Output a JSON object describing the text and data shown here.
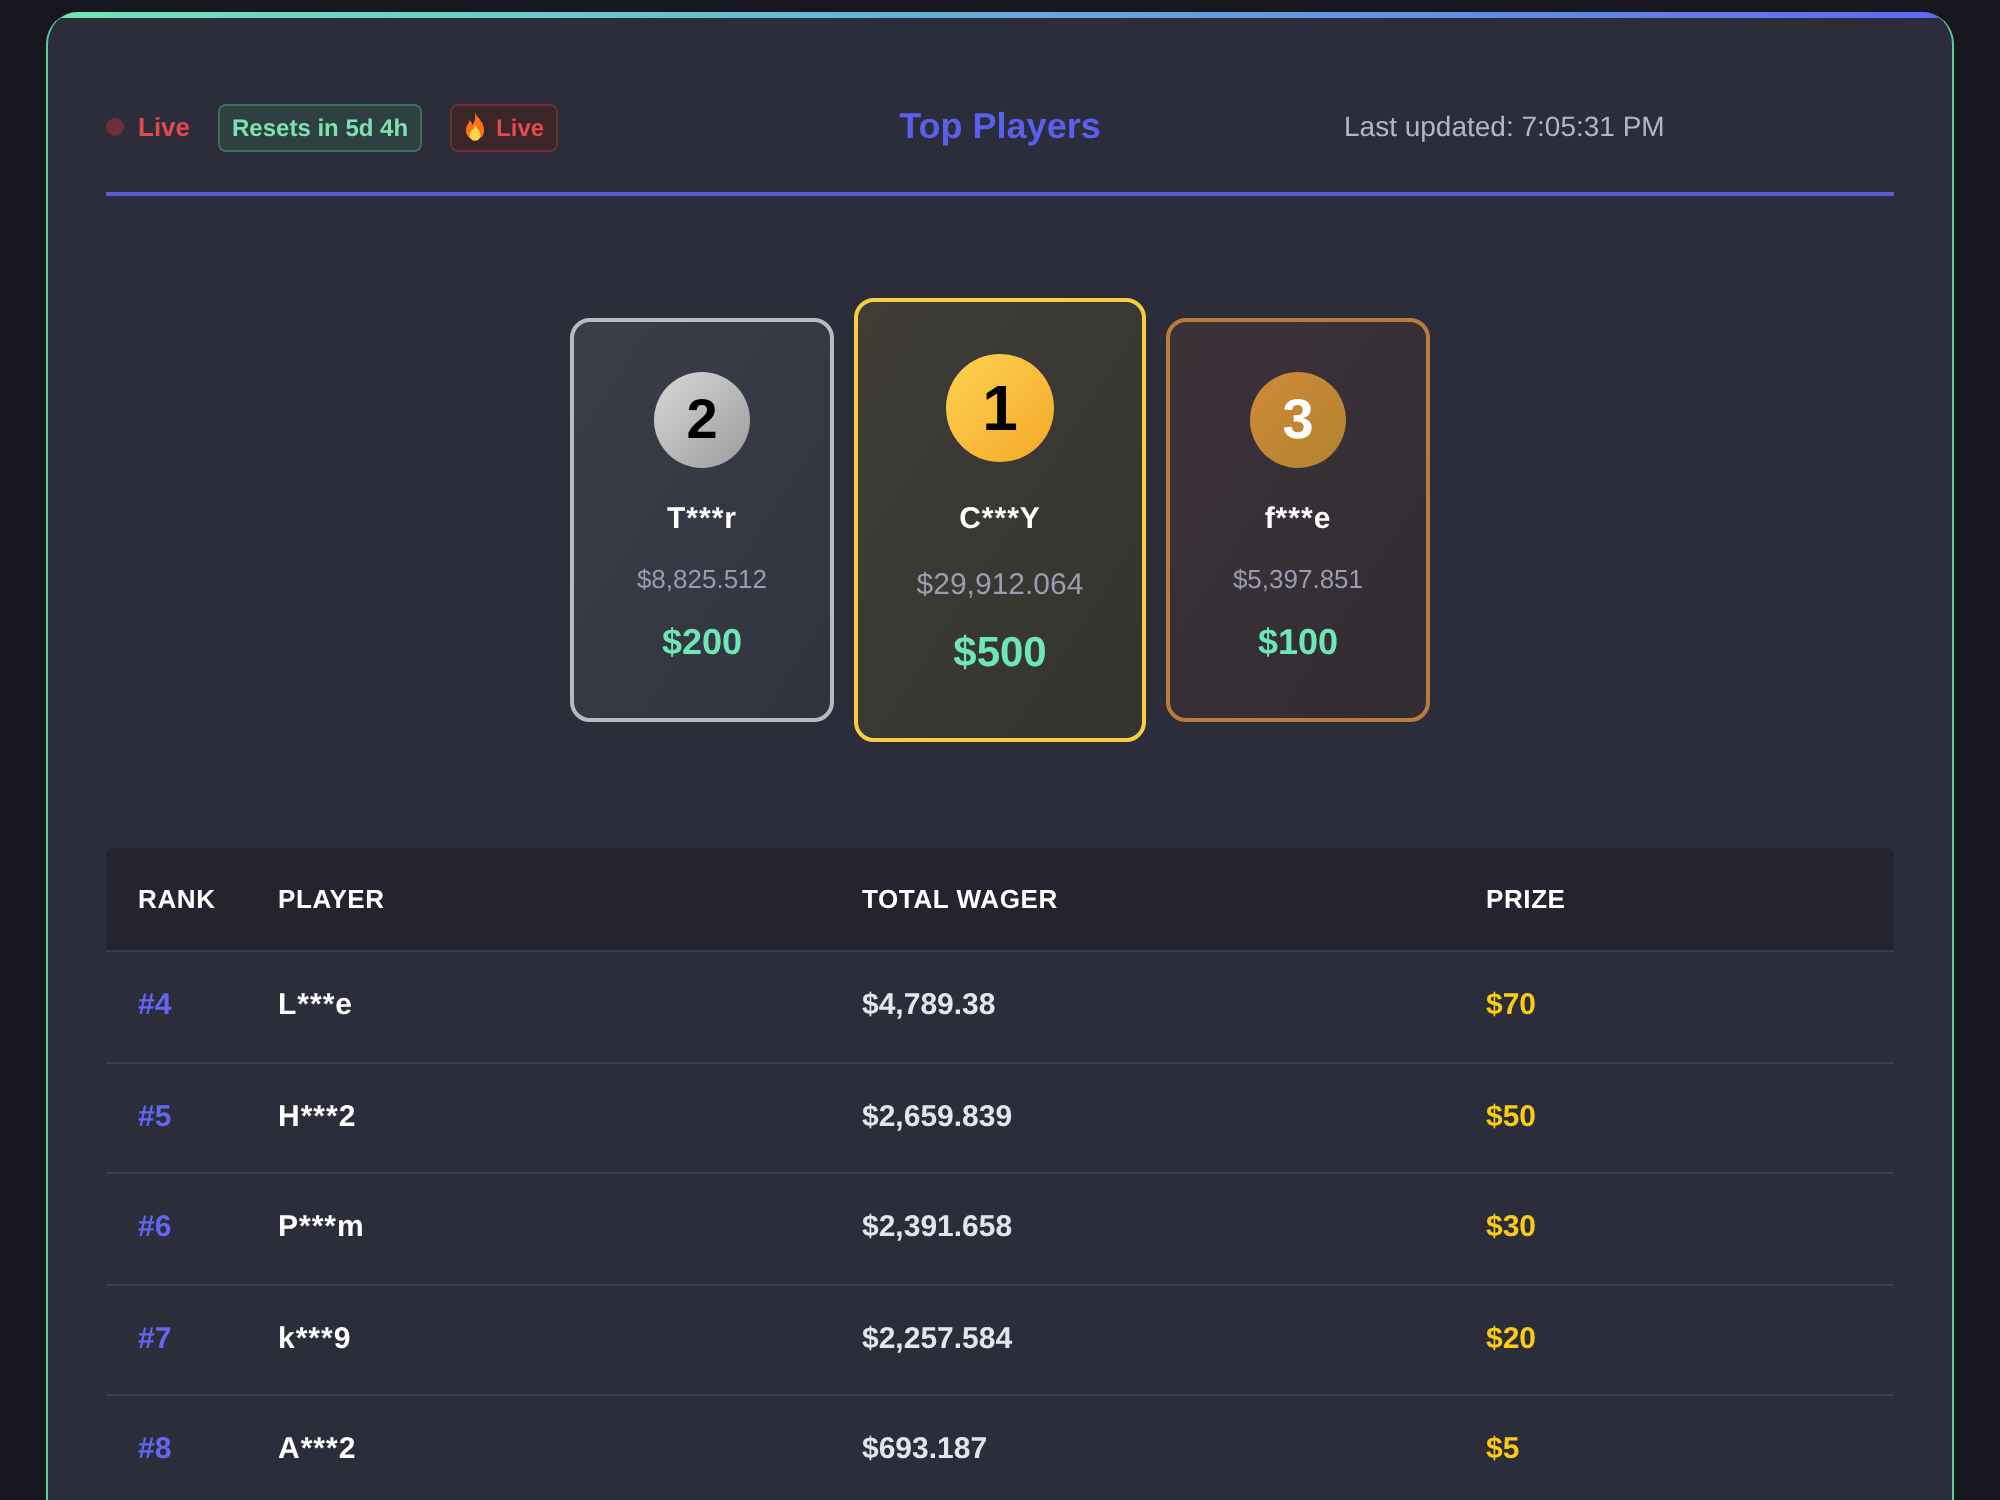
{
  "header": {
    "badges": [
      {
        "kind": "status",
        "label": "Live"
      },
      {
        "kind": "timer",
        "label": "Resets in 5d 4h"
      },
      {
        "kind": "hot",
        "label": "Live"
      }
    ],
    "title": "Top Players",
    "last_updated": "Last updated: 7:05:31 PM"
  },
  "podium": [
    {
      "kind": "silver",
      "rank": "2",
      "player": "T***r",
      "wager": "$8,825.512",
      "prize": "$200"
    },
    {
      "kind": "gold",
      "rank": "1",
      "player": "C***Y",
      "wager": "$29,912.064",
      "prize": "$500"
    },
    {
      "kind": "bronze",
      "rank": "3",
      "player": "f***e",
      "wager": "$5,397.851",
      "prize": "$100"
    }
  ],
  "table": {
    "columns": [
      "RANK",
      "PLAYER",
      "TOTAL WAGER",
      "PRIZE"
    ],
    "rows": [
      {
        "rank": "#4",
        "player": "L***e",
        "wager": "$4,789.38",
        "prize": "$70"
      },
      {
        "rank": "#5",
        "player": "H***2",
        "wager": "$2,659.839",
        "prize": "$50"
      },
      {
        "rank": "#6",
        "player": "P***m",
        "wager": "$2,391.658",
        "prize": "$30"
      },
      {
        "rank": "#7",
        "player": "k***9",
        "wager": "$2,257.584",
        "prize": "$20"
      },
      {
        "rank": "#8",
        "player": "A***2",
        "wager": "$693.187",
        "prize": "$5"
      }
    ]
  }
}
